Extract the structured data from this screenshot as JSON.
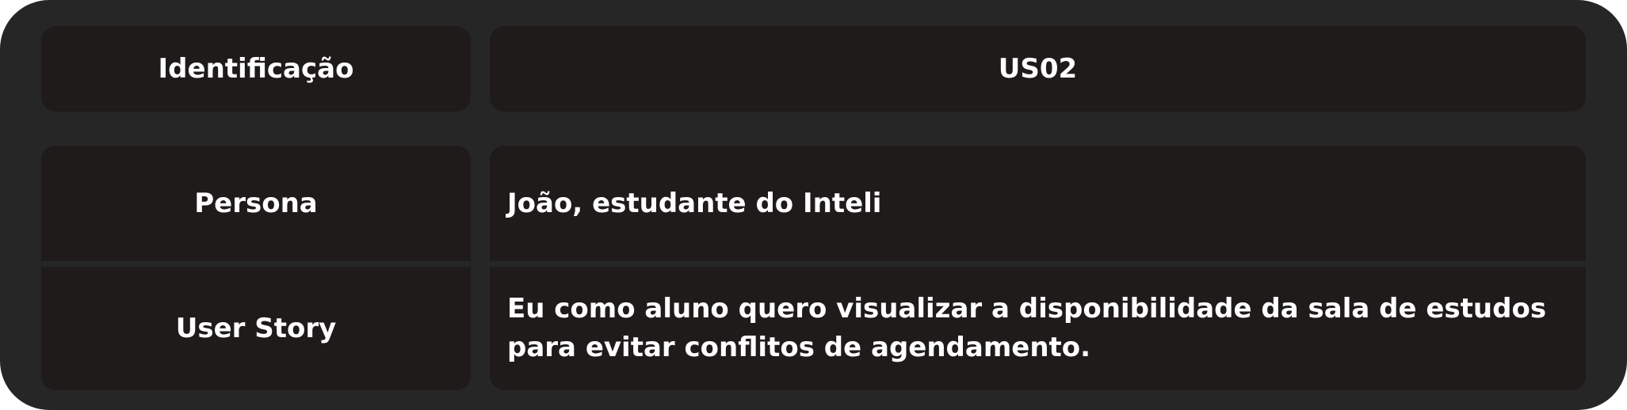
{
  "table": {
    "identification": {
      "label": "Identificação",
      "value": "US02"
    },
    "persona": {
      "label": "Persona",
      "value": "João, estudante do Inteli"
    },
    "user_story": {
      "label": "User Story",
      "value": "Eu como aluno quero visualizar a disponibilidade da sala de estudos para evitar conflitos de agendamento."
    }
  },
  "colors": {
    "frame": "#262626",
    "cell": "#1f1b1b",
    "text": "#ffffff"
  }
}
